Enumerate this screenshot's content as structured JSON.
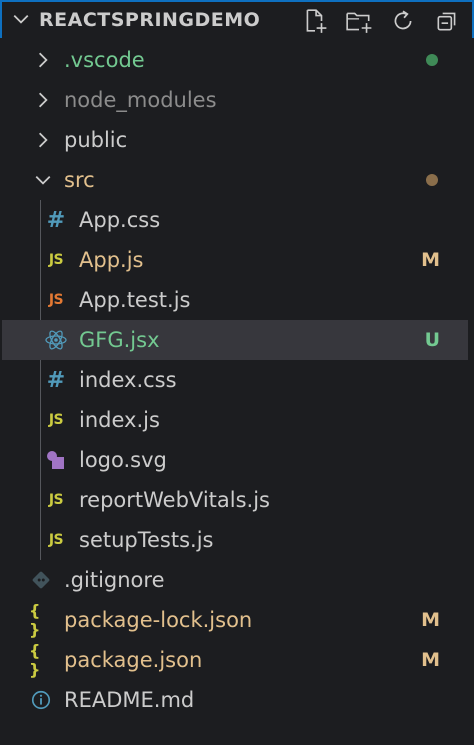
{
  "explorer": {
    "title": "REACTSPRINGDEMO",
    "actions": [
      {
        "icon": "new-file-icon"
      },
      {
        "icon": "new-folder-icon"
      },
      {
        "icon": "refresh-icon"
      },
      {
        "icon": "collapse-all-icon"
      }
    ]
  },
  "colors": {
    "accent": "#0e70c0",
    "selected_row": "#37373d",
    "modified": "#e2c08d",
    "untracked": "#73c991",
    "ignored": "#8c8c8c",
    "js": "#cbcb41",
    "css": "#519aba",
    "react": "#519aba",
    "json": "#cbcb41",
    "svg": "#a074c4",
    "git": "#41535b"
  },
  "tree": {
    "items": [
      {
        "label": ".vscode",
        "type": "folder",
        "expanded": false,
        "status": "dot-green"
      },
      {
        "label": "node_modules",
        "type": "folder",
        "expanded": false,
        "status": "ignored"
      },
      {
        "label": "public",
        "type": "folder",
        "expanded": false,
        "status": ""
      },
      {
        "label": "src",
        "type": "folder",
        "expanded": true,
        "status": "dot-orange"
      },
      {
        "label": "App.css",
        "type": "file",
        "icon": "css-hash-icon",
        "badge": ""
      },
      {
        "label": "App.js",
        "type": "file",
        "icon": "js-icon",
        "badge": "M"
      },
      {
        "label": "App.test.js",
        "type": "file",
        "icon": "js-test-icon",
        "badge": ""
      },
      {
        "label": "GFG.jsx",
        "type": "file",
        "icon": "react-icon",
        "badge": "U"
      },
      {
        "label": "index.css",
        "type": "file",
        "icon": "css-hash-icon",
        "badge": ""
      },
      {
        "label": "index.js",
        "type": "file",
        "icon": "js-icon",
        "badge": ""
      },
      {
        "label": "logo.svg",
        "type": "file",
        "icon": "svg-icon",
        "badge": ""
      },
      {
        "label": "reportWebVitals.js",
        "type": "file",
        "icon": "js-icon",
        "badge": ""
      },
      {
        "label": "setupTests.js",
        "type": "file",
        "icon": "js-icon",
        "badge": ""
      },
      {
        "label": ".gitignore",
        "type": "file",
        "icon": "git-icon",
        "badge": ""
      },
      {
        "label": "package-lock.json",
        "type": "file",
        "icon": "json-icon",
        "badge": "M"
      },
      {
        "label": "package.json",
        "type": "file",
        "icon": "json-icon",
        "badge": "M"
      },
      {
        "label": "README.md",
        "type": "file",
        "icon": "info-icon",
        "badge": ""
      }
    ]
  },
  "icon_glyphs": {
    "js": "JS",
    "css": "#",
    "json": "{ }",
    "info": "i"
  }
}
